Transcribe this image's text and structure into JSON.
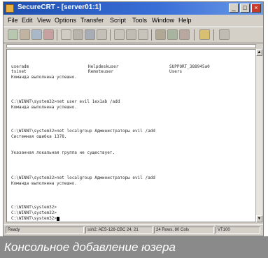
{
  "window": {
    "title": "SecureCRT - [server01:1]"
  },
  "menubar": {
    "items": [
      "File",
      "Edit",
      "View",
      "Options",
      "Transfer",
      "Script",
      "Tools",
      "Window",
      "Help"
    ]
  },
  "toolbar": {
    "icons": [
      "connect-icon",
      "quick-connect-icon",
      "reconnect-icon",
      "disconnect-icon",
      "copy-icon",
      "paste-icon",
      "find-icon",
      "print-icon",
      "log-icon",
      "session-options-icon",
      "global-options-icon",
      "sftp-icon",
      "keymap-icon",
      "help-icon",
      "about-icon"
    ]
  },
  "console": {
    "header_row": {
      "col1": "useradm",
      "col2": "Helpdeskuser",
      "col3": "SUPPORT_388945a0"
    },
    "header_row2": {
      "col1": "tsinet",
      "col2": "Remoteuser",
      "col3": "Users"
    },
    "lines": [
      "Команда выполнена успешно.",
      "C:\\WINNT\\system32>net user evil 1ex1ab /add",
      "Команда выполнена успешно.",
      "C:\\WINNT\\system32>net localgroup Администраторы evil /add",
      "Системная ошибка 1378.",
      "Указанная локальная группа не существует.",
      "C:\\WINNT\\system32>net localgroup Администраторы evil /add",
      "Команда выполнена успешно.",
      "C:\\WINNT\\system32>",
      "C:\\WINNT\\system32>",
      "C:\\WINNT\\system32>"
    ]
  },
  "statusbar": {
    "ready": "Ready",
    "cipher": "ssh2: AES-128-CBC   24, 21",
    "size": "24 Rows, 80 Cols",
    "term": "VT100"
  },
  "caption": "Консольное добавление юзера"
}
